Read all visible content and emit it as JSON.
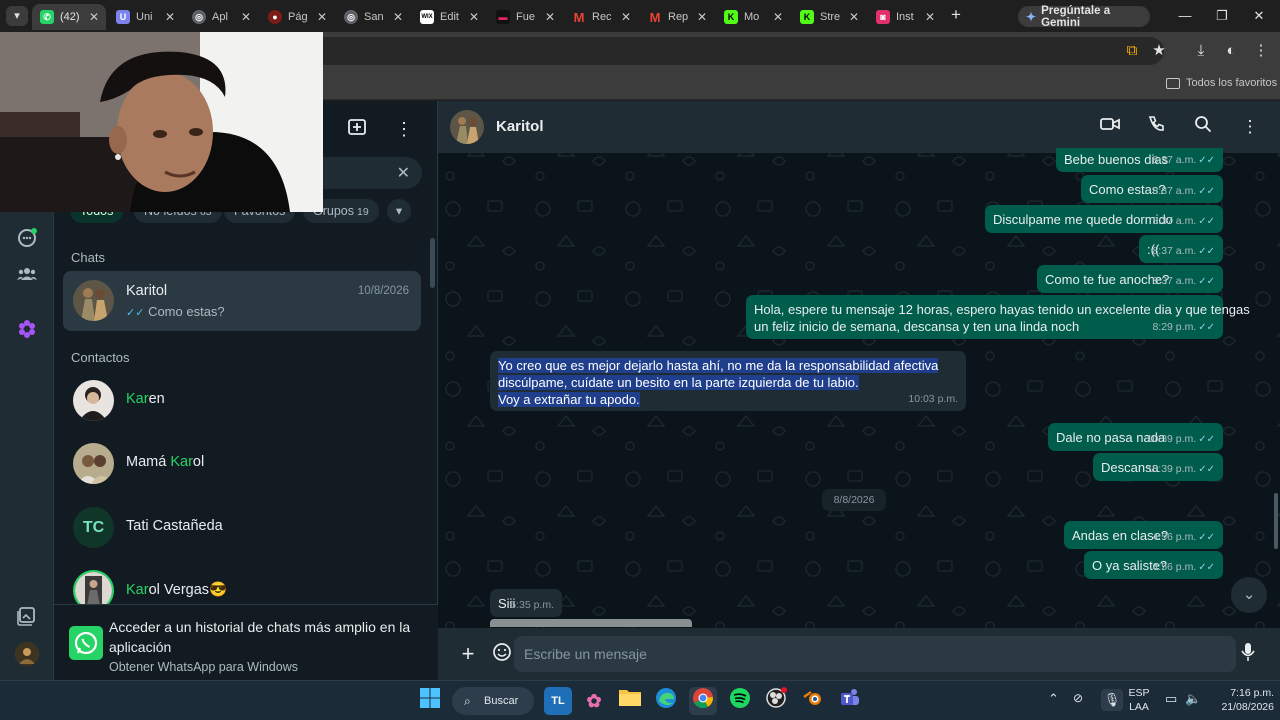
{
  "browser": {
    "tabs": [
      {
        "label": "(42)",
        "icon": "whatsapp-icon",
        "color": "#25d366",
        "active": true
      },
      {
        "label": "Uni",
        "icon": "teams-icon",
        "color": "#7b83eb"
      },
      {
        "label": "Apl",
        "icon": "globe-icon",
        "color": "#9aa0a6"
      },
      {
        "label": "Pág",
        "icon": "mask-icon",
        "color": "#b3261e"
      },
      {
        "label": "San",
        "icon": "globe-icon",
        "color": "#9aa0a6"
      },
      {
        "label": "Edit",
        "icon": "wix-icon",
        "color": "#ffffff"
      },
      {
        "label": "Fue",
        "icon": "media-icon",
        "color": "#e0245e"
      },
      {
        "label": "Rec",
        "icon": "gmail-icon",
        "color": "#ea4335"
      },
      {
        "label": "Rep",
        "icon": "gmail-icon",
        "color": "#ea4335"
      },
      {
        "label": "Mo",
        "icon": "kick-icon",
        "color": "#53fc18"
      },
      {
        "label": "Stre",
        "icon": "kick-icon",
        "color": "#53fc18"
      },
      {
        "label": "Inst",
        "icon": "instagram-icon",
        "color": "#e1306c"
      }
    ],
    "gemini_label": "Pregúntale a Gemini",
    "bookmarks_folder": "Todos los favoritos"
  },
  "sidebar": {
    "chips": [
      {
        "label": "Todos",
        "count": ""
      },
      {
        "label": "No leídos",
        "count": "63"
      },
      {
        "label": "Favoritos",
        "count": ""
      },
      {
        "label": "Grupos",
        "count": "19"
      }
    ],
    "chats_title": "Chats",
    "chat": {
      "name": "Karitol",
      "date": "10/8/2026",
      "last": "Como estas?"
    },
    "contacts_title": "Contactos",
    "contacts": [
      {
        "match": "Kar",
        "rest": "en",
        "prefix": ""
      },
      {
        "prefix": "Mamá ",
        "match": "Kar",
        "rest": "ol"
      },
      {
        "prefix": "",
        "match": "",
        "rest": "Tati Castañeda",
        "initials": "TC"
      },
      {
        "prefix": "",
        "match": "Kar",
        "rest": "ol Vergas😎"
      }
    ],
    "promo": {
      "title": "Acceder a un historial de chats más amplio en la aplicación",
      "subtitle": "Obtener WhatsApp para Windows"
    }
  },
  "chat": {
    "title": "Karitol",
    "composer_placeholder": "Escribe un mensaje",
    "date_separator": "8/8/2026",
    "messages": [
      {
        "dir": "out",
        "text": "Bebe buenos dias",
        "time": "8:37 a.m."
      },
      {
        "dir": "out",
        "text": "Como estas?",
        "time": "8:37 a.m."
      },
      {
        "dir": "out",
        "text": "Disculpame me quede dormido",
        "time": "8:37 a.m."
      },
      {
        "dir": "out",
        "text": ":((",
        "time": "8:37 a.m."
      },
      {
        "dir": "out",
        "text": "Como te fue anoche?",
        "time": "8:37 a.m."
      },
      {
        "dir": "out",
        "text1": "Hola, espere tu mensaje 12 horas, espero hayas tenido un excelente dia y que tengas",
        "text2": "un feliz inicio de semana, descansa y ten una linda noch",
        "time": "8:29 p.m."
      },
      {
        "dir": "in",
        "text1": "Yo creo que es mejor dejarlo hasta ahí, no me da la responsabilidad afectiva",
        "text2": "discúlpame, cuídate un besito en la parte izquierda de tu labio.",
        "text3": "Voy a extrañar tu apodo.",
        "time": "10:03 p.m."
      },
      {
        "dir": "out",
        "text": "Dale no pasa nada",
        "time": "10:39 p.m."
      },
      {
        "dir": "out",
        "text": "Descansa",
        "time": "10:39 p.m."
      },
      {
        "dir": "out",
        "text": "Andas en clase?",
        "time": "4:56 p.m."
      },
      {
        "dir": "out",
        "text": "O ya saliste?",
        "time": "4:56 p.m."
      },
      {
        "dir": "in",
        "text": "Siii",
        "time": "5:35 p.m."
      }
    ]
  },
  "taskbar": {
    "search_label": "Buscar",
    "lang1": "ESP",
    "lang2": "LAA",
    "time": "7:16 p.m.",
    "date": "21/08/2026"
  },
  "colors": {
    "accent": "#25d366",
    "outgoing_bubble": "#005c4b",
    "incoming_bubble": "#202c33",
    "selection": "#1f3f8c"
  }
}
